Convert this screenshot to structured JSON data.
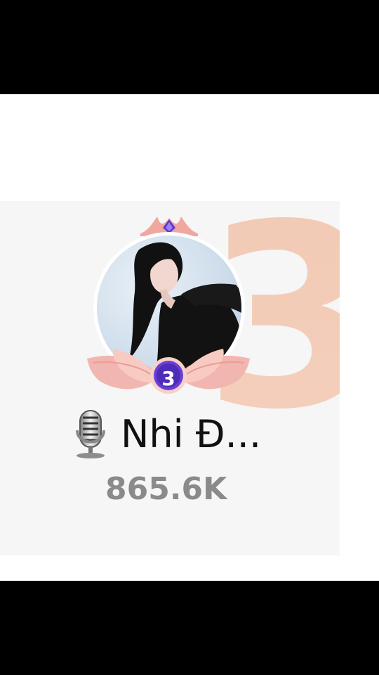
{
  "leaderboard_card": {
    "rank": "3",
    "display_name": "Nhi Đ...",
    "score": "865.6K",
    "colors": {
      "rank_numeral": "#f3c3a9",
      "badge": "#6a3fd6",
      "lotus": "#f2b6b0",
      "score_text": "#8a8a8a"
    },
    "icons": {
      "crown": "crown-icon",
      "mic": "microphone-icon",
      "lotus": "lotus-rank-frame"
    }
  }
}
